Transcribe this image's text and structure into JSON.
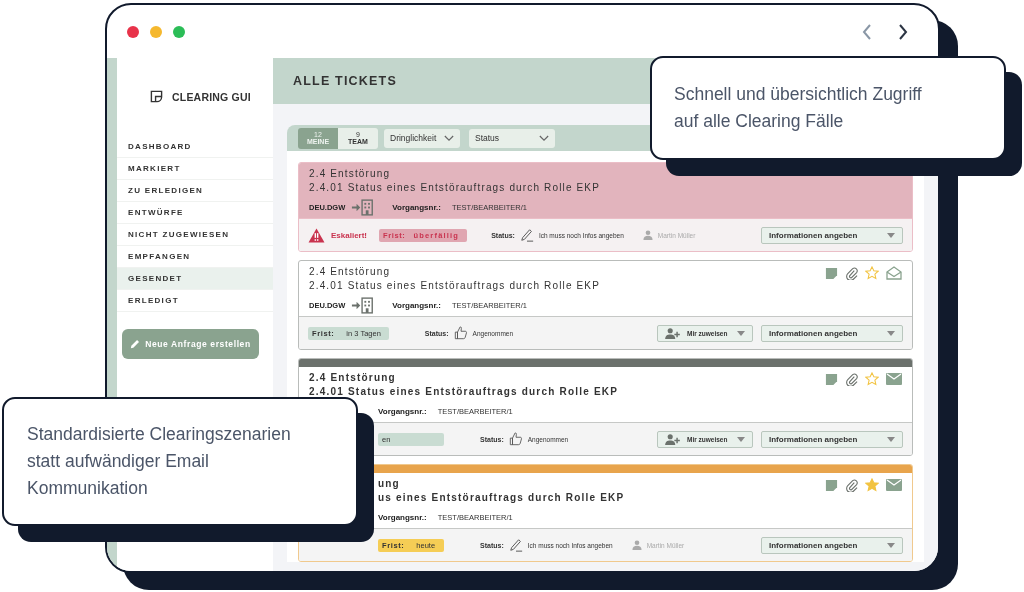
{
  "window": {
    "controls": [
      {
        "color": "#e8334a"
      },
      {
        "color": "#f5b82e"
      },
      {
        "color": "#2bbd57"
      }
    ]
  },
  "sidebar": {
    "logo": "CLEARING GUI",
    "items": [
      {
        "label": "DASHBOARD",
        "selected": false
      },
      {
        "label": "MARKIERT",
        "selected": false
      },
      {
        "label": "ZU ERLEDIGEN",
        "selected": false
      },
      {
        "label": "ENTWÜRFE",
        "selected": false
      },
      {
        "label": "NICHT ZUGEWIESEN",
        "selected": false
      },
      {
        "label": "EMPFANGEN",
        "selected": false
      },
      {
        "label": "GESENDET",
        "selected": true
      },
      {
        "label": "ERLEDIGT",
        "selected": false
      }
    ],
    "new_button": "Neue Anfrage erstellen"
  },
  "header": {
    "title": "ALLE TICKETS"
  },
  "toolbar": {
    "tabs": [
      {
        "count": "12",
        "label": "MEINE",
        "selected": true
      },
      {
        "count": "9",
        "label": "TEAM",
        "selected": false
      }
    ],
    "filters": [
      "Dringlichkeit",
      "Status"
    ]
  },
  "tickets": [
    {
      "kind": "escalated",
      "unread": false,
      "title": "2.4 Entstörung",
      "subtitle": "2.4.01 Status eines Entstörauftrags durch Rolle EKP",
      "org": "DEU.DGW",
      "ref_label": "Vorgangsnr.:",
      "ref": "TEST/BEARBEITER/1",
      "escalation": "Eskaliert!",
      "frist": {
        "label": "Frist:",
        "value": "überfällig",
        "color": "#e0a6b1"
      },
      "status_label": "Status:",
      "status": {
        "kind": "pencil",
        "text": "Ich muss noch Infos angeben"
      },
      "assignee": "Martin Müller",
      "action": "Informationen angeben"
    },
    {
      "kind": "normal",
      "unread": false,
      "icons": true,
      "starred": false,
      "read": true,
      "title": "2.4 Entstörung",
      "subtitle": "2.4.01 Status eines Entstörauftrags durch Rolle EKP",
      "org": "DEU.DGW",
      "ref_label": "Vorgangsnr.:",
      "ref": "TEST/BEARBEITER/1",
      "frist": {
        "label": "Frist:",
        "value": "in 3 Tagen",
        "color": "#c9dcd2"
      },
      "status_label": "Status:",
      "status": {
        "kind": "thumb",
        "text": "Angenommen"
      },
      "assign": "Mir zuweisen",
      "action": "Informationen angeben"
    },
    {
      "kind": "normal",
      "color": "#6b716c",
      "unread": true,
      "icons": true,
      "starred": false,
      "read": false,
      "title": "2.4 Entstörung",
      "subtitle": "2.4.01 Status eines Entstörauftrags durch Rolle EKP",
      "ref_label": "Vorgangsnr.:",
      "ref": "TEST/BEARBEITER/1",
      "frist": {
        "value": "en",
        "color": "#c9dcd2"
      },
      "status_label": "Status:",
      "status": {
        "kind": "thumb",
        "text": "Angenommen"
      },
      "assign": "Mir zuweisen",
      "action": "Informationen angeben"
    },
    {
      "kind": "normal",
      "color": "#e8a44c",
      "unread": true,
      "icons": true,
      "starred": true,
      "read": false,
      "title": "ung",
      "subtitle": "us eines Entstörauftrags durch Rolle EKP",
      "ref_label": "Vorgangsnr.:",
      "ref": "TEST/BEARBEITER/1",
      "frist": {
        "label": "Frist:",
        "value": "heute",
        "color": "#f5cd55"
      },
      "status_label": "Status:",
      "status": {
        "kind": "pencil",
        "text": "Ich muss noch Infos angeben"
      },
      "assignee": "Martin Müller",
      "action": "Informationen angeben"
    }
  ],
  "callouts": [
    {
      "text": "Schnell und übersichtlich Zugriff auf alle Clearing Fälle"
    },
    {
      "text": "Standardisierte Clearingszenarien statt aufwändiger Email Kommunikation"
    }
  ]
}
